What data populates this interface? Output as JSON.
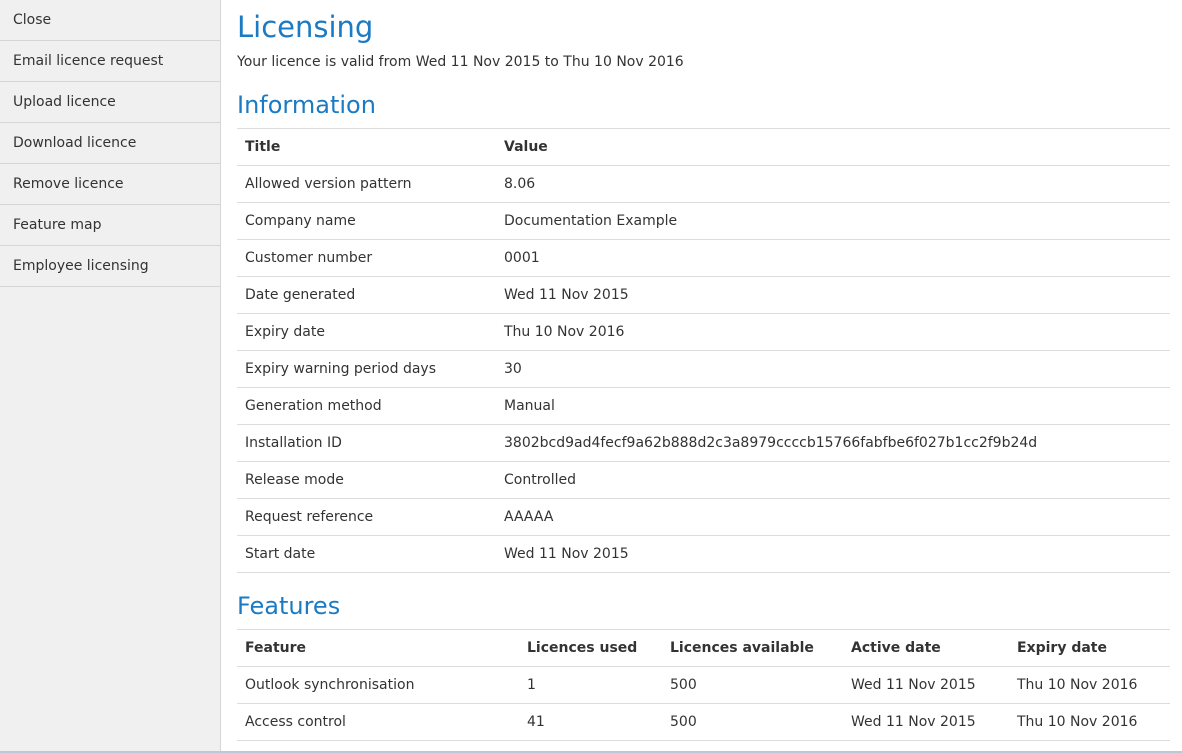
{
  "sidebar": {
    "items": [
      {
        "label": "Close"
      },
      {
        "label": "Email licence request"
      },
      {
        "label": "Upload licence"
      },
      {
        "label": "Download licence"
      },
      {
        "label": "Remove licence"
      },
      {
        "label": "Feature map"
      },
      {
        "label": "Employee licensing"
      }
    ]
  },
  "page": {
    "title": "Licensing",
    "validity": "Your licence is valid from Wed 11 Nov 2015 to Thu 10 Nov 2016"
  },
  "information": {
    "title": "Information",
    "headers": [
      "Title",
      "Value"
    ],
    "rows": [
      [
        "Allowed version pattern",
        "8.06"
      ],
      [
        "Company name",
        "Documentation Example"
      ],
      [
        "Customer number",
        "0001"
      ],
      [
        "Date generated",
        "Wed 11 Nov 2015"
      ],
      [
        "Expiry date",
        "Thu 10 Nov 2016"
      ],
      [
        "Expiry warning period days",
        "30"
      ],
      [
        "Generation method",
        "Manual"
      ],
      [
        "Installation ID",
        "3802bcd9ad4fecf9a62b888d2c3a8979ccccb15766fabfbe6f027b1cc2f9b24d"
      ],
      [
        "Release mode",
        "Controlled"
      ],
      [
        "Request reference",
        "AAAAA"
      ],
      [
        "Start date",
        "Wed 11 Nov 2015"
      ]
    ]
  },
  "features": {
    "title": "Features",
    "headers": [
      "Feature",
      "Licences used",
      "Licences available",
      "Active date",
      "Expiry date"
    ],
    "rows": [
      [
        "Outlook synchronisation",
        "1",
        "500",
        "Wed 11 Nov 2015",
        "Thu 10 Nov 2016"
      ],
      [
        "Access control",
        "41",
        "500",
        "Wed 11 Nov 2015",
        "Thu 10 Nov 2016"
      ]
    ]
  },
  "colors": {
    "accent": "#1a7bc4",
    "sidebar_bg": "#f0f0f0"
  }
}
